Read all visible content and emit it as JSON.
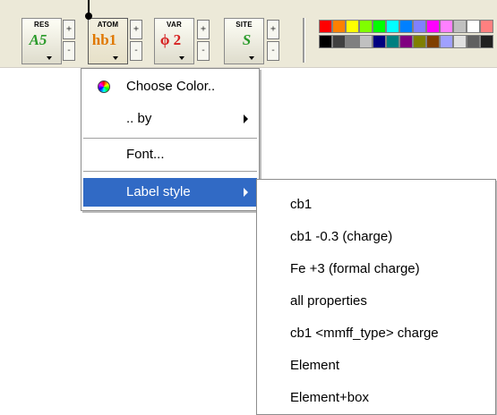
{
  "toolbar": {
    "buttons": [
      {
        "caption": "RES",
        "glyph": "A5",
        "glyph_color": "#2a9a2a",
        "spin_up": "+",
        "spin_down": "-"
      },
      {
        "caption": "ATOM",
        "glyph": "hb1",
        "glyph_color": "#e07800",
        "spin_up": "+",
        "spin_down": "-"
      },
      {
        "caption": "VAR",
        "glyph": "ϕ 2",
        "glyph_color": "#d62020",
        "spin_up": "+",
        "spin_down": "-"
      },
      {
        "caption": "SITE",
        "glyph": "S",
        "glyph_color": "#2a9a2a",
        "spin_up": "+",
        "spin_down": "-"
      }
    ],
    "palette_colors": [
      [
        "#ff0000",
        "#ff8000",
        "#ffff00",
        "#80ff00",
        "#00ff00",
        "#00ffff",
        "#0080ff",
        "#8080ff",
        "#ff00ff",
        "#ff80ff",
        "#c0c0c0",
        "#ffffff",
        "#ff8080"
      ],
      [
        "#000000",
        "#404040",
        "#808080",
        "#c0c0c0",
        "#000080",
        "#008080",
        "#800080",
        "#808000",
        "#804000",
        "#a0a0ff",
        "#e0e0e0",
        "#606060",
        "#202020"
      ]
    ]
  },
  "menu": {
    "items": [
      {
        "label": "Choose Color..",
        "icon": "color-wheel-icon",
        "submenu": false
      },
      {
        "label": ".. by",
        "submenu": true
      },
      {
        "label": "Font...",
        "submenu": false
      },
      {
        "label": "Label style",
        "submenu": true,
        "highlighted": true
      }
    ]
  },
  "submenu": {
    "items": [
      {
        "label": "cb1"
      },
      {
        "label": "cb1 -0.3 (charge)"
      },
      {
        "label": "Fe +3 (formal charge)"
      },
      {
        "label": "all properties"
      },
      {
        "label": "cb1 <mmff_type> charge"
      },
      {
        "label": "Element"
      },
      {
        "label": "Element+box"
      }
    ]
  }
}
